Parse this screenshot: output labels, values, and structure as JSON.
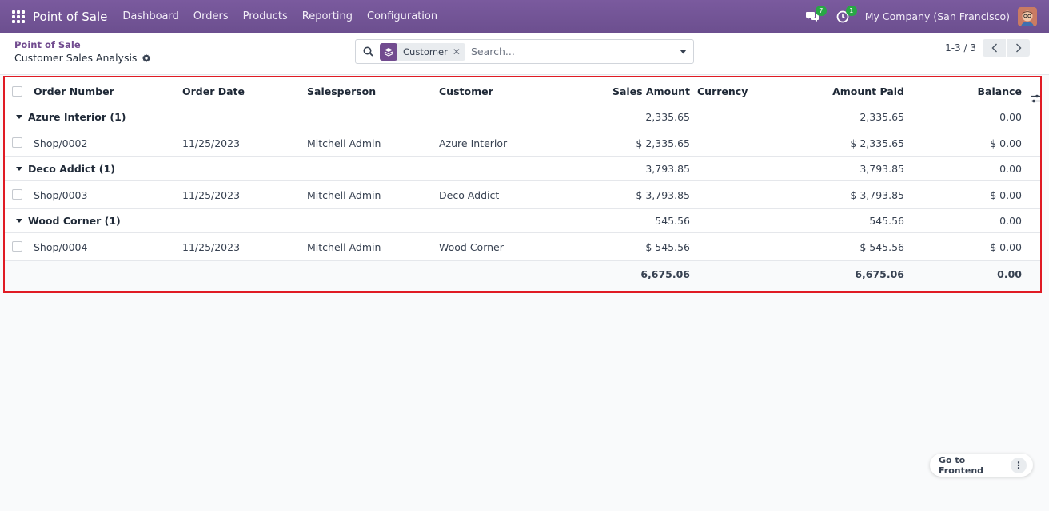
{
  "navbar": {
    "brand": "Point of Sale",
    "menu": [
      "Dashboard",
      "Orders",
      "Products",
      "Reporting",
      "Configuration"
    ],
    "messages_count": "7",
    "activities_count": "1",
    "company": "My Company (San Francisco)"
  },
  "breadcrumb": {
    "parent": "Point of Sale",
    "current": "Customer Sales Analysis"
  },
  "search": {
    "facet_label": "Customer",
    "placeholder": "Search..."
  },
  "pager": {
    "value": "1-3 / 3"
  },
  "table": {
    "columns": [
      "Order Number",
      "Order Date",
      "Salesperson",
      "Customer",
      "Sales Amount",
      "Currency",
      "Amount Paid",
      "Balance"
    ],
    "groups": [
      {
        "name": "Azure Interior (1)",
        "sales": "2,335.65",
        "paid": "2,335.65",
        "balance": "0.00",
        "record": {
          "order": "Shop/0002",
          "date": "11/25/2023",
          "salesperson": "Mitchell Admin",
          "customer": "Azure Interior",
          "sales": "$ 2,335.65",
          "paid": "$ 2,335.65",
          "balance": "$ 0.00"
        }
      },
      {
        "name": "Deco Addict (1)",
        "sales": "3,793.85",
        "paid": "3,793.85",
        "balance": "0.00",
        "record": {
          "order": "Shop/0003",
          "date": "11/25/2023",
          "salesperson": "Mitchell Admin",
          "customer": "Deco Addict",
          "sales": "$ 3,793.85",
          "paid": "$ 3,793.85",
          "balance": "$ 0.00"
        }
      },
      {
        "name": "Wood Corner (1)",
        "sales": "545.56",
        "paid": "545.56",
        "balance": "0.00",
        "record": {
          "order": "Shop/0004",
          "date": "11/25/2023",
          "salesperson": "Mitchell Admin",
          "customer": "Wood Corner",
          "sales": "$ 545.56",
          "paid": "$ 545.56",
          "balance": "$ 0.00"
        }
      }
    ],
    "totals": {
      "sales": "6,675.06",
      "paid": "6,675.06",
      "balance": "0.00"
    }
  },
  "floating": {
    "go_to_frontend": "Go to Frontend",
    "more": "⋮"
  },
  "colors": {
    "brand": "#714b8f",
    "highlight_border": "#e01b24",
    "badge": "#28a745"
  }
}
